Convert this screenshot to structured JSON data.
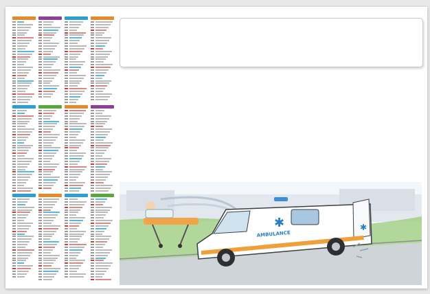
{
  "calendar": {
    "year_badge": "",
    "month_colors": [
      "#e58a2b",
      "#8e3f96",
      "#2b9fd4",
      "#e58a2b",
      "#2b9fd4",
      "#5aa83c",
      "#e58a2b",
      "#8e3f96",
      "#2b9fd4",
      "#e58a2b",
      "#2b9fd4",
      "#5aa83c"
    ],
    "days_per_month": [
      31,
      29,
      31,
      30,
      31,
      30,
      31,
      31,
      30,
      31,
      30,
      31
    ]
  },
  "illustration": {
    "subject": "ambulance-scene",
    "vehicle_text": "AMBULANCE"
  }
}
